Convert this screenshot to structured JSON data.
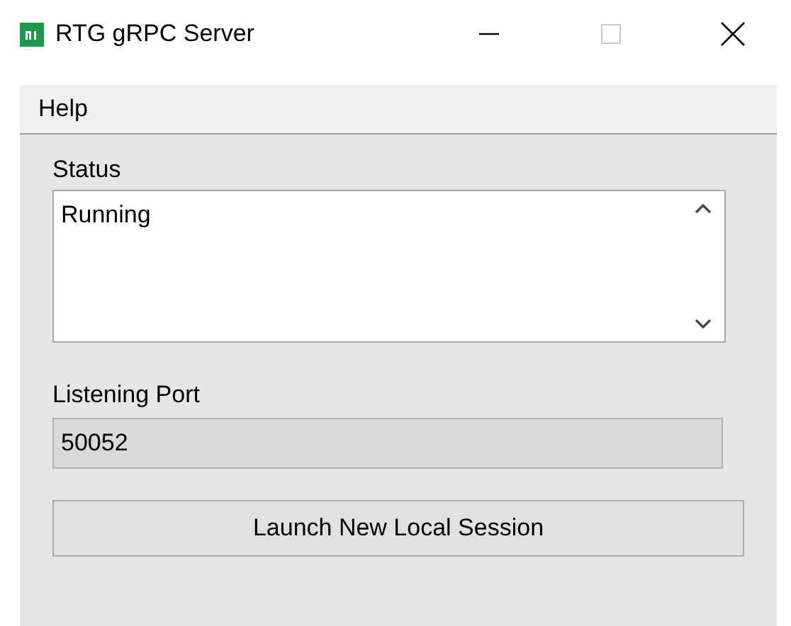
{
  "window": {
    "title": "RTG gRPC Server",
    "maximize_enabled": false
  },
  "menu": [
    {
      "label": "Help"
    }
  ],
  "status": {
    "label": "Status",
    "value": "Running"
  },
  "port": {
    "label": "Listening Port",
    "value": "50052",
    "read_only": true
  },
  "button": {
    "label": "Launch New Local Session"
  }
}
